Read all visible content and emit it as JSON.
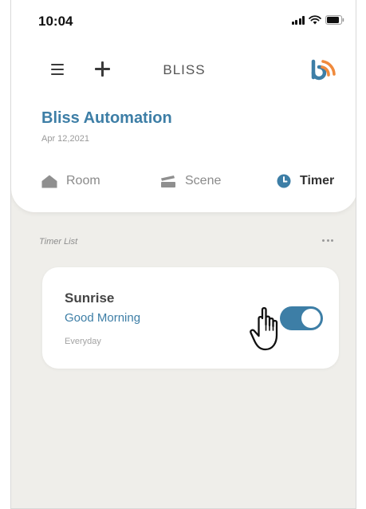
{
  "status_bar": {
    "time": "10:04"
  },
  "header": {
    "title": "BLISS"
  },
  "home": {
    "title": "Bliss Automation",
    "date": "Apr 12,2021"
  },
  "tabs": [
    {
      "label": "Room",
      "icon": "house-icon",
      "active": false
    },
    {
      "label": "Scene",
      "icon": "scene-icon",
      "active": false
    },
    {
      "label": "Timer",
      "icon": "clock-icon",
      "active": true
    }
  ],
  "timer_list": {
    "title": "Timer List",
    "items": [
      {
        "name": "Sunrise",
        "description": "Good Morning",
        "repeat": "Everyday",
        "enabled": true
      }
    ]
  },
  "colors": {
    "accent": "#3d7ea6",
    "logo_orange": "#f08a3c",
    "logo_blue": "#3d7ea6",
    "background": "#efeeea"
  }
}
